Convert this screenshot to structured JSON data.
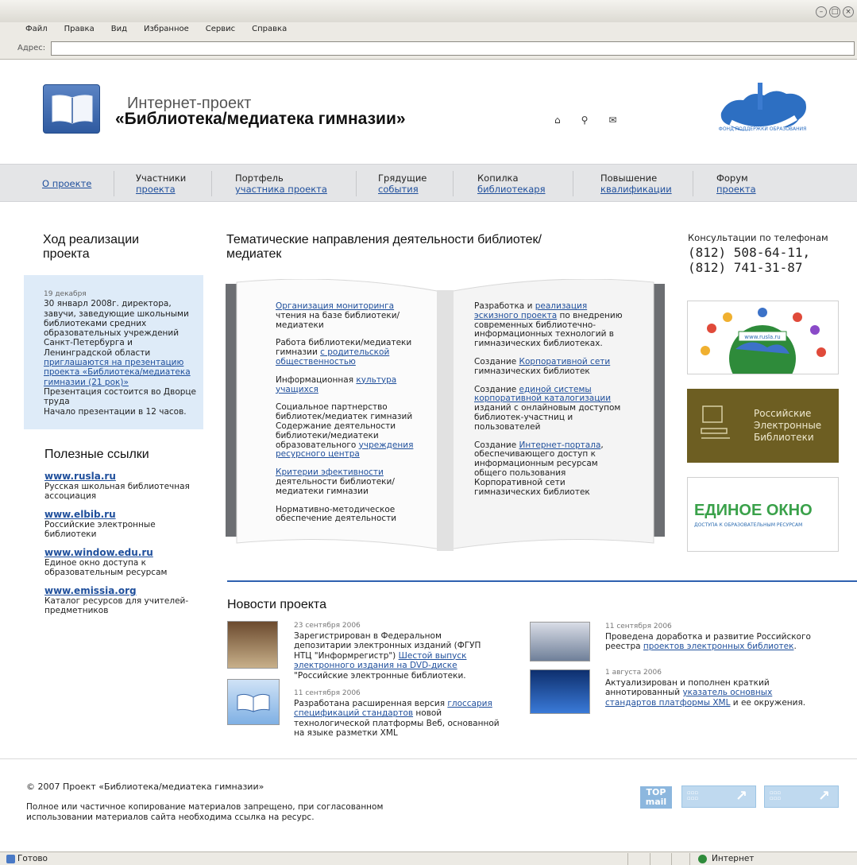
{
  "browser": {
    "menu": [
      "Файл",
      "Правка",
      "Вид",
      "Избранное",
      "Сервис",
      "Справка"
    ],
    "address_label": "Адрес:",
    "status_ready": "Готово",
    "status_zone": "Интернет"
  },
  "header": {
    "title_line1": "Интернет-проект",
    "title_line2": "«Библиотека/медиатека гимназии»",
    "map_caption": "ФОНД ПОДДЕРЖКИ ОБРАЗОВАНИЯ"
  },
  "nav": [
    {
      "line1": "О проекте",
      "line2": ""
    },
    {
      "line1": "Участники",
      "line2": "проекта"
    },
    {
      "line1": "Портфель",
      "line2": "участника проекта"
    },
    {
      "line1": "Грядущие",
      "line2": "события"
    },
    {
      "line1": "Копилка",
      "line2": "библиотекаря"
    },
    {
      "line1": "Повышение",
      "line2": "квалификации"
    },
    {
      "line1": "Форум",
      "line2": "проекта"
    }
  ],
  "progress": {
    "title": "Ход реализации проекта",
    "date": "19 декабря",
    "text1": "30 январл 2008г. директора, завучи, заведующие школьными библиотеками средних образовательных учреждений Санкт-Петербурга и Ленинградской области",
    "link": "приглашаются на презентацию проекта «Библиотека/медиатека гимназии (21 рок)»",
    "text2": "Презентация состоится во Дворце труда",
    "text3": "Начало презентации в 12 часов."
  },
  "links": {
    "title": "Полезные ссылки",
    "items": [
      {
        "url": "www.rusla.ru",
        "desc": "Русская школьная библиотечная ассоциация"
      },
      {
        "url": "www.elbib.ru",
        "desc": "Российские электронные библиотеки"
      },
      {
        "url": "www.window.edu.ru",
        "desc": "Единое окно доступа к образовательным ресурсам"
      },
      {
        "url": "www.emissia.org",
        "desc": "Каталог ресурсов для учителей-предметников"
      }
    ]
  },
  "topics": {
    "title": "Тематические направления деятельности библиотек/медиатек",
    "left": [
      {
        "pre": "",
        "link": "Организация мониторинга",
        "post": " чтения на базе библиотеки/медиатеки"
      },
      {
        "pre": "Работа библиотеки/медиатеки гимназии ",
        "link": "с родительской общественностью",
        "post": ""
      },
      {
        "pre": "Информационная ",
        "link": "культура учащихся",
        "post": ""
      },
      {
        "pre": "Социальное партнерство библиотек/медиатек гимназий Содержание деятельности библиотеки/медиатеки образовательного ",
        "link": "учреждения ресурсного центра",
        "post": ""
      },
      {
        "pre": "",
        "link": "Критерии эфективности",
        "post": " деятельности библиотеки/ медиатеки гимназии"
      },
      {
        "pre": "Нормативно-методическое обеспечение деятельности",
        "link": "",
        "post": ""
      }
    ],
    "right": [
      {
        "pre": "Разработка и ",
        "link": "реализация эскизного проекта",
        "post": " по внедрению современных библиотечно-информационных технологий в гимназических библиотеках."
      },
      {
        "pre": "Создание ",
        "link": "Корпоративной сети",
        "post": " гимназических библиотек"
      },
      {
        "pre": "Создание ",
        "link": "единой системы корпоративной каталогизации",
        "post": " изданий с онлайновым доступом библиотек-участниц и пользователей"
      },
      {
        "pre": "Создание ",
        "link": "Интернет-портала",
        "post": ", обеспечивающего доступ к информационным ресурсам общего пользования Корпоративной сети гимназических библиотек"
      }
    ]
  },
  "contacts": {
    "label": "Консультации по телефонам",
    "phone1": "(812) 508-64-11,",
    "phone2": "(812) 741-31-87"
  },
  "banners": {
    "rusla_caption": "www.rusla.ru",
    "elbib": "Российские Электронные Библиотеки",
    "window_big": "ЕДИНОЕ ОКНО",
    "window_small": "ДОСТУПА К ОБРАЗОВАТЕЛЬНЫМ РЕСУРСАМ"
  },
  "news": {
    "title": "Новости проекта",
    "items": [
      {
        "date": "23 сентября 2006",
        "pre": "Зарегистрирован в Федеральном депозитарии электронных изданий (ФГУП НТЦ \"Информрегистр\") ",
        "link": "Шестой выпуск электронного издания на DVD-диске",
        "post": " \"Российские электронные библиотеки."
      },
      {
        "date": "11 сентября 2006",
        "pre": "Разработана расширенная версия ",
        "link": "глоссария спецификаций стандартов",
        "post": " новой технологической платформы Веб, основанной на языке разметки XML"
      },
      {
        "date": "11 сентября 2006",
        "pre": "Проведена доработка и развитие Российского реестра ",
        "link": "проектов электронных библиотек",
        "post": "."
      },
      {
        "date": "1 августа 2006",
        "pre": "Актуализирован и пополнен краткий аннотированный ",
        "link": "указатель основных стандартов платформы XML",
        "post": " и ее окружения."
      }
    ]
  },
  "footer": {
    "copyright": "© 2007 Проект «Библиотека/медиатека гимназии»",
    "legal": "Полное или частичное копирование материалов запрещено, при согласованном использовании материалов сайта необходима ссылка на ресурс.",
    "topmail": "TOP mail"
  }
}
